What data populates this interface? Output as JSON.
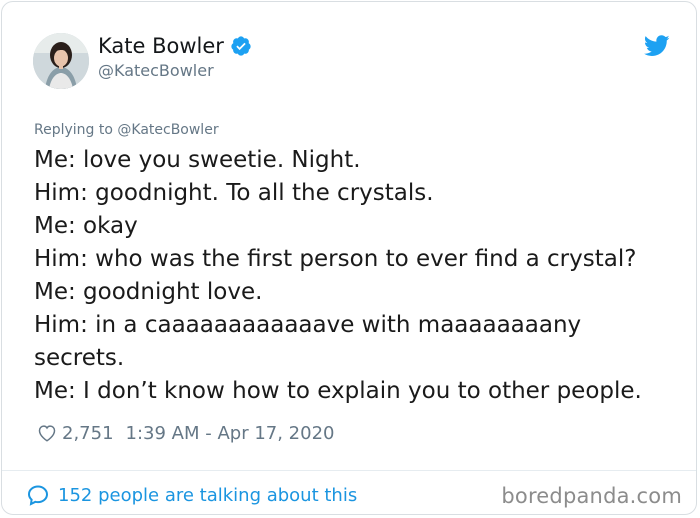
{
  "author": {
    "name": "Kate Bowler",
    "handle": "@KatecBowler",
    "verified": true
  },
  "reply": {
    "text": "Replying to @KatecBowler"
  },
  "tweet": {
    "lines": [
      "Me: love you sweetie. Night.",
      "Him: goodnight. To all the crystals.",
      "Me: okay",
      "Him: who was the first person to ever find a crystal?",
      "Me: goodnight love.",
      "Him: in a caaaaaaaaaaaave with maaaaaaaany",
      "secrets.",
      "Me: I don’t know how to explain you to other people."
    ]
  },
  "meta": {
    "likes": "2,751",
    "timestamp": "1:39 AM - Apr 17, 2020"
  },
  "footer": {
    "talking": "152 people are talking about this",
    "watermark": "boredpanda.com"
  },
  "icons": {
    "verified": "verified-badge-icon",
    "bird": "twitter-bird-icon",
    "heart": "heart-icon",
    "bubble": "reply-bubble-icon"
  },
  "colors": {
    "accent": "#1da1f2",
    "link": "#1b95e0",
    "muted": "#657786",
    "text": "#1a1a1a"
  }
}
